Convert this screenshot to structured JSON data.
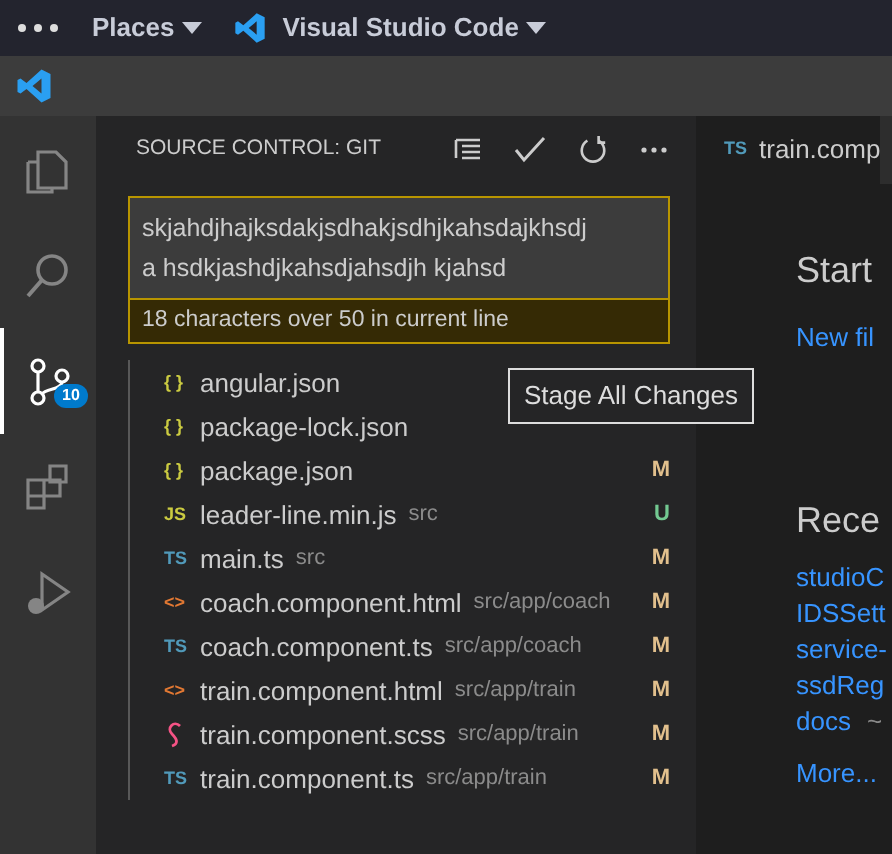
{
  "top_bar": {
    "places": "Places",
    "app": "Visual Studio Code"
  },
  "activity_bar": [
    {
      "kind": "explorer",
      "selected": false
    },
    {
      "kind": "search",
      "selected": false
    },
    {
      "kind": "scm",
      "selected": true,
      "badge": "10"
    },
    {
      "kind": "extensions",
      "selected": false
    },
    {
      "kind": "debug",
      "selected": false
    }
  ],
  "sidebar": {
    "title": "SOURCE CONTROL: GIT",
    "commit_message": {
      "value": "skjahdjhajksdakjsdhakjsdhjkahsdajkhsdja hsdkjashdjkahsdjahsdjh kjahsd",
      "warning": "18 characters over 50 in current line"
    },
    "changes": [
      {
        "kind": "json",
        "icon": "{ }",
        "name": "angular.json"
      },
      {
        "kind": "json",
        "icon": "{ }",
        "name": "package-lock.json"
      },
      {
        "kind": "json",
        "icon": "{ }",
        "name": "package.json",
        "status": "M",
        "color": "#e2c08d"
      },
      {
        "kind": "js",
        "icon": "JS",
        "name": "leader-line.min.js",
        "path": "src",
        "status": "U",
        "color": "#73c991"
      },
      {
        "kind": "ts",
        "icon": "TS",
        "name": "main.ts",
        "path": "src",
        "status": "M",
        "color": "#e2c08d"
      },
      {
        "kind": "html",
        "icon": "<>",
        "name": "coach.component.html",
        "path": "src/app/coach",
        "status": "M",
        "color": "#e2c08d"
      },
      {
        "kind": "ts",
        "icon": "TS",
        "name": "coach.component.ts",
        "path": "src/app/coach",
        "status": "M",
        "color": "#e2c08d"
      },
      {
        "kind": "html",
        "icon": "<>",
        "name": "train.component.html",
        "path": "src/app/train",
        "status": "M",
        "color": "#e2c08d"
      },
      {
        "kind": "scss",
        "name": "train.component.scss",
        "path": "src/app/train",
        "status": "M",
        "color": "#e2c08d"
      },
      {
        "kind": "ts",
        "icon": "TS",
        "name": "train.component.ts",
        "path": "src/app/train",
        "status": "M",
        "color": "#e2c08d"
      }
    ]
  },
  "tooltip": "Stage All Changes",
  "editor": {
    "tabs": [
      {
        "icon": "TS",
        "label": "train.comp",
        "selected": true
      }
    ],
    "start": {
      "heading": "Start",
      "links": [
        "New fil"
      ]
    },
    "recent": {
      "heading": "Rece",
      "items": [
        {
          "name": "studioC"
        },
        {
          "name": "IDSSett"
        },
        {
          "name": "service-"
        },
        {
          "name": "ssdReg"
        },
        {
          "name": "docs",
          "path": "~"
        }
      ],
      "more": "More..."
    }
  }
}
